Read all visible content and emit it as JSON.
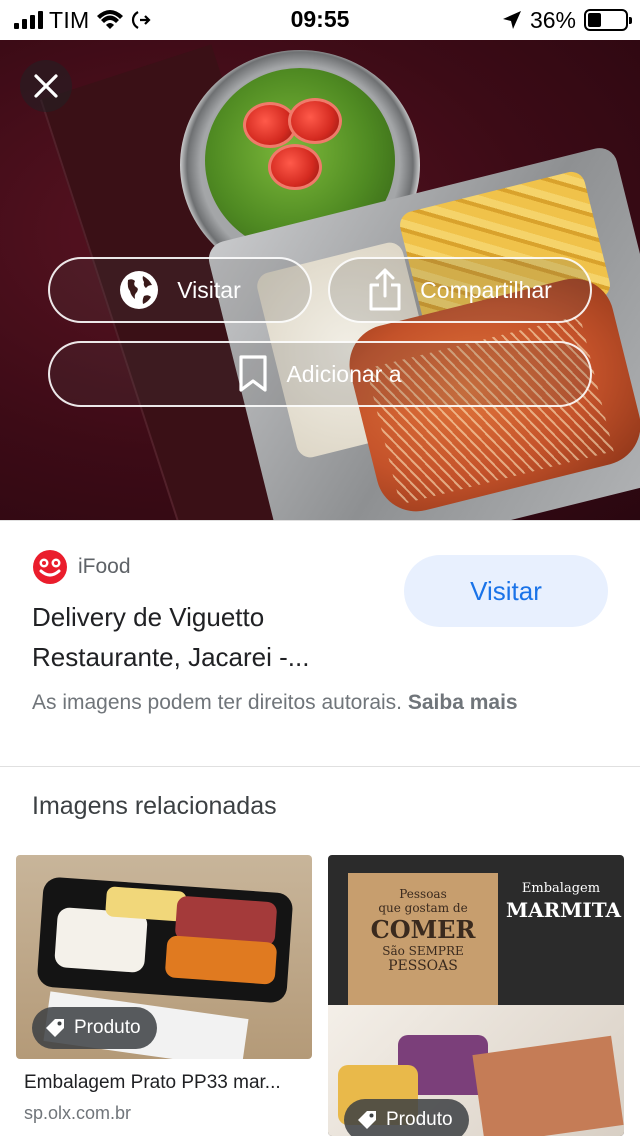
{
  "status_bar": {
    "carrier": "TIM",
    "time": "09:55",
    "battery": "36%",
    "battery_level": 0.36
  },
  "hero": {
    "actions": {
      "visit_label": "Visitar",
      "share_label": "Compartilhar",
      "add_to_label": "Adicionar a"
    }
  },
  "source": {
    "site_name": "iFood",
    "title": "Delivery de Viguetto Restaurante, Jacarei -...",
    "visit_button": "Visitar",
    "copyright_text": "As imagens podem ter direitos autorais.",
    "learn_more": "Saiba mais"
  },
  "related": {
    "heading": "Imagens relacionadas",
    "items": [
      {
        "badge": "Produto",
        "title": "Embalagem Prato PP33 mar...",
        "source": "sp.olx.com.br"
      },
      {
        "badge": "Produto",
        "image_text": {
          "line1": "Pessoas",
          "line2": "que gostam de",
          "big": "COMER",
          "line3": "São SEMPRE",
          "line4": "PESSOAS",
          "brand_top": "Embalagem",
          "brand_big": "MARMITA"
        }
      }
    ]
  },
  "colors": {
    "accent": "#1a73e8",
    "visit_bg": "#e8f0fe"
  }
}
